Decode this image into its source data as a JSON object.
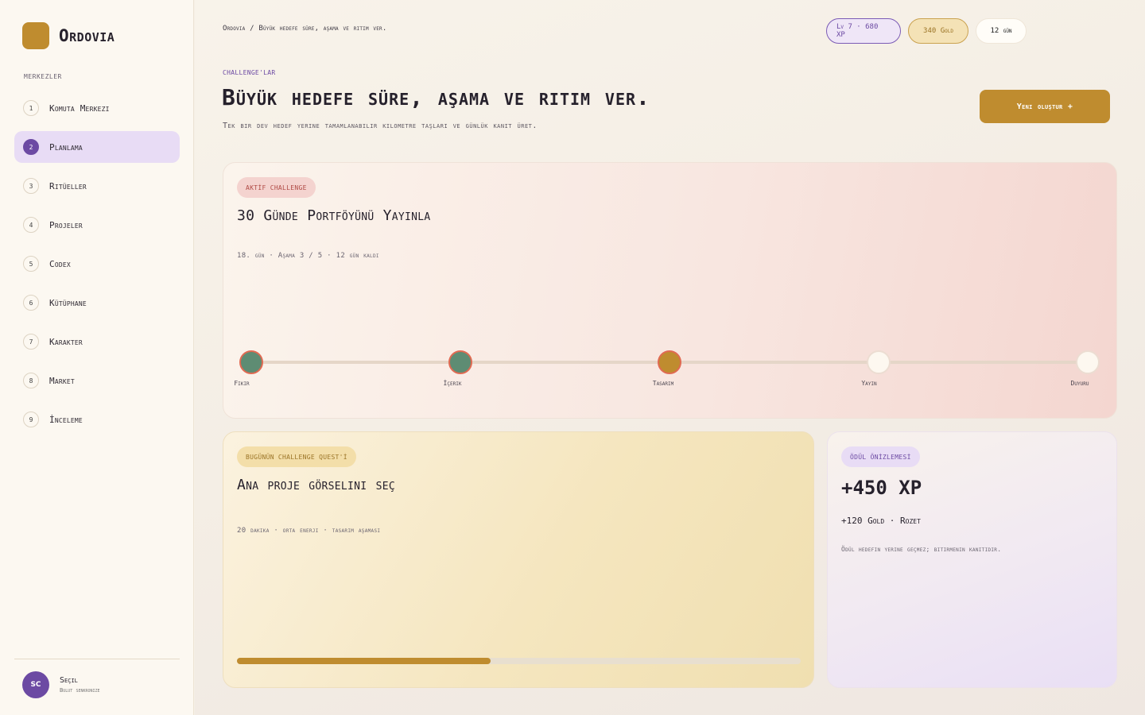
{
  "app": {
    "name": "Ordovia"
  },
  "sidebar": {
    "section_label": "MERKEZLER",
    "items": [
      {
        "num": "1",
        "label": "Komuta Merkezi",
        "active": false
      },
      {
        "num": "2",
        "label": "Planlama",
        "active": true
      },
      {
        "num": "3",
        "label": "Ritüeller",
        "active": false
      },
      {
        "num": "4",
        "label": "Projeler",
        "active": false
      },
      {
        "num": "5",
        "label": "Codex",
        "active": false
      },
      {
        "num": "6",
        "label": "Kütüphane",
        "active": false
      },
      {
        "num": "7",
        "label": "Karakter",
        "active": false
      },
      {
        "num": "8",
        "label": "Market",
        "active": false
      },
      {
        "num": "9",
        "label": "İnceleme",
        "active": false
      }
    ],
    "user": {
      "initials": "SC",
      "name": "Seçil",
      "status": "Bulut senkronize"
    }
  },
  "header": {
    "breadcrumb": "Ordovia / Büyük hedefe süre, aşama ve ritim ver.",
    "stats": {
      "xp": "Lv 7 · 680 XP",
      "gold": "340 Gold",
      "days": "12 gün"
    }
  },
  "page": {
    "eyebrow": "CHALLENGE'LAR",
    "title": "Büyük hedefe süre, aşama ve ritim ver.",
    "subtitle": "Tek bir dev hedef yerine tamamlanabilir kilometre taşları ve günlük kanıt üret.",
    "create_button": "Yeni oluştur +"
  },
  "challenge": {
    "tag": "AKTİF CHALLENGE",
    "title": "30 Günde Portföyünü Yayınla",
    "meta": "18. gün · Aşama 3 / 5 · 12 gün kaldı",
    "stages": [
      {
        "label": "Fikir",
        "status": "done"
      },
      {
        "label": "İçerik",
        "status": "done"
      },
      {
        "label": "Tasarım",
        "status": "current"
      },
      {
        "label": "Yayın",
        "status": "todo"
      },
      {
        "label": "Duyuru",
        "status": "todo"
      }
    ]
  },
  "quest": {
    "tag": "BUGÜNÜN CHALLENGE QUEST'İ",
    "title": "Ana proje görselini seç",
    "meta": "20 dakika · orta enerji · tasarım aşaması",
    "progress": 0.45
  },
  "reward": {
    "tag": "ÖDÜL ÖNİZLEMESİ",
    "xp": "+450 XP",
    "sub": "+120 Gold · Rozet",
    "note": "Ödül hedefin yerine geçmez; bitirmenin kanıtıdır."
  },
  "colors": {
    "accent_gold": "#bf8c2f",
    "accent_purple": "#6c4aa3",
    "stage_done": "#5e8c73"
  }
}
